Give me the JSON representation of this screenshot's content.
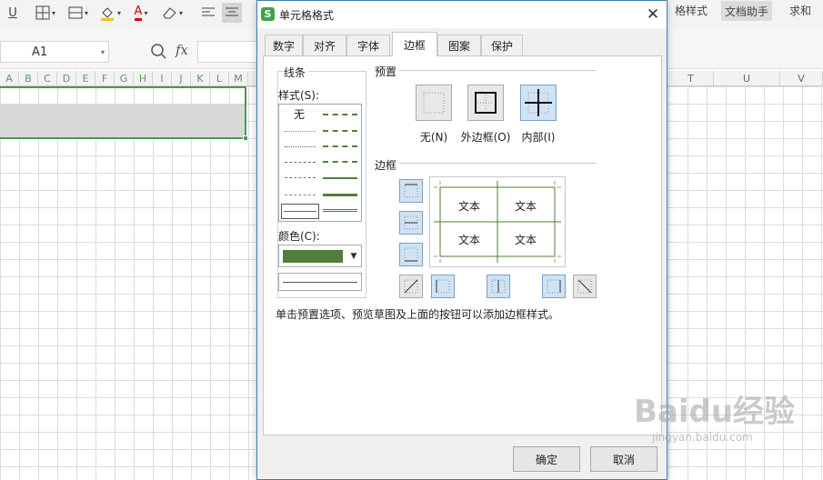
{
  "toolbar": {
    "underline_glyph": "U",
    "font_color_glyph": "A",
    "right_button_1": "格样式",
    "right_button_2": "文档助手",
    "right_button_3": "求和"
  },
  "formula": {
    "cell_ref": "A1",
    "fx_label": "fx"
  },
  "columns": {
    "left": [
      "A",
      "B",
      "C",
      "D",
      "E",
      "F",
      "G",
      "H",
      "I",
      "J",
      "K",
      "L",
      "M"
    ],
    "right": [
      "T",
      "U",
      "V"
    ]
  },
  "dialog": {
    "title": "单元格格式",
    "app_icon": "S",
    "close": "✕",
    "tabs": [
      "数字",
      "对齐",
      "字体",
      "边框",
      "图案",
      "保护"
    ],
    "active_tab": "边框",
    "line_group": "线条",
    "style_label": "样式(S):",
    "style_none": "无",
    "color_label": "颜色(C):",
    "color_value": "#4f7f3a",
    "preset_group": "预置",
    "presets": [
      "无(N)",
      "外边框(O)",
      "内部(I)"
    ],
    "border_group": "边框",
    "preview_cells": [
      "文本",
      "文本",
      "文本",
      "文本"
    ],
    "hint": "单击预置选项、预览草图及上面的按钮可以添加边框样式。",
    "ok": "确定",
    "cancel": "取消"
  },
  "watermark": {
    "brand": "Baidu经验",
    "url": "jingyan.baidu.com"
  }
}
